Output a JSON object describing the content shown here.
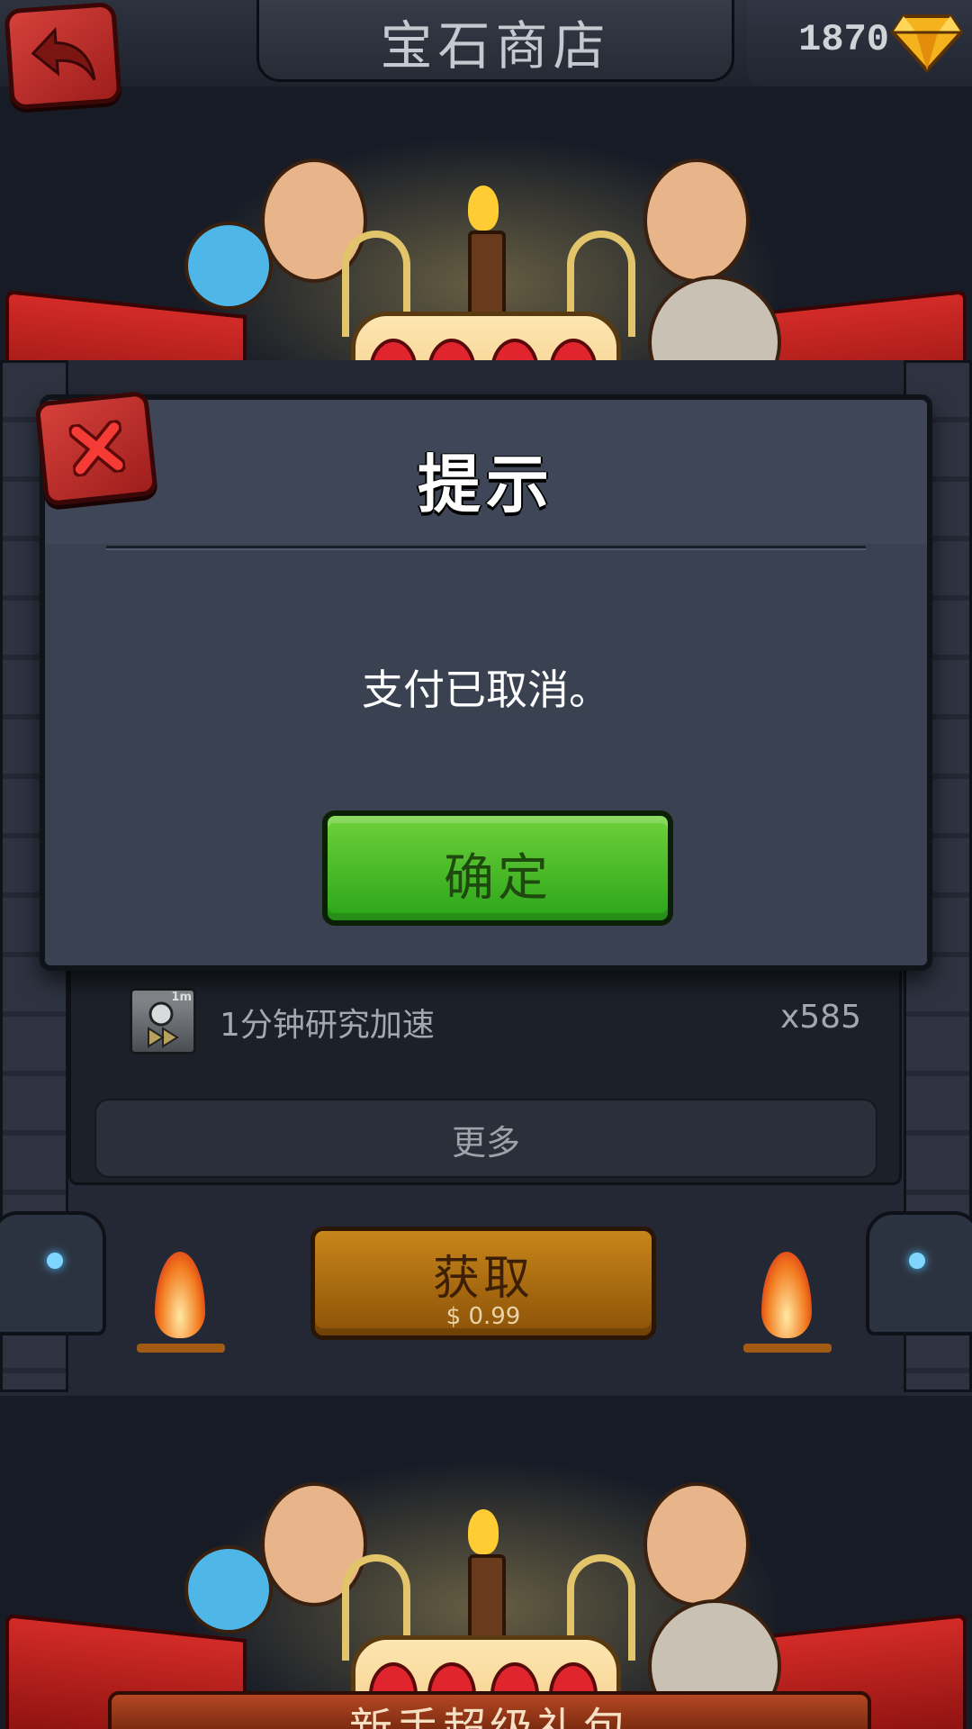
{
  "header": {
    "title": "宝石商店",
    "gem_count": "1870",
    "back_icon": "back-arrow-icon",
    "gem_icon": "gem-icon"
  },
  "banner": {
    "caption": "新手超级礼包"
  },
  "dialog": {
    "title": "提示",
    "message": "支付已取消。",
    "confirm_label": "确定",
    "close_icon": "close-x-icon"
  },
  "package_items": [
    {
      "icon": "research-speedup-icon",
      "badge": "1m",
      "name": "1分钟研究加速",
      "quantity": "x585"
    }
  ],
  "more_label": "更多",
  "purchase": {
    "label": "获取",
    "price": "$ 0.99"
  },
  "colors": {
    "accent_green": "#3fb424",
    "danger_red": "#c2302c",
    "gold_button": "#b07014",
    "panel": "#3a4252"
  }
}
